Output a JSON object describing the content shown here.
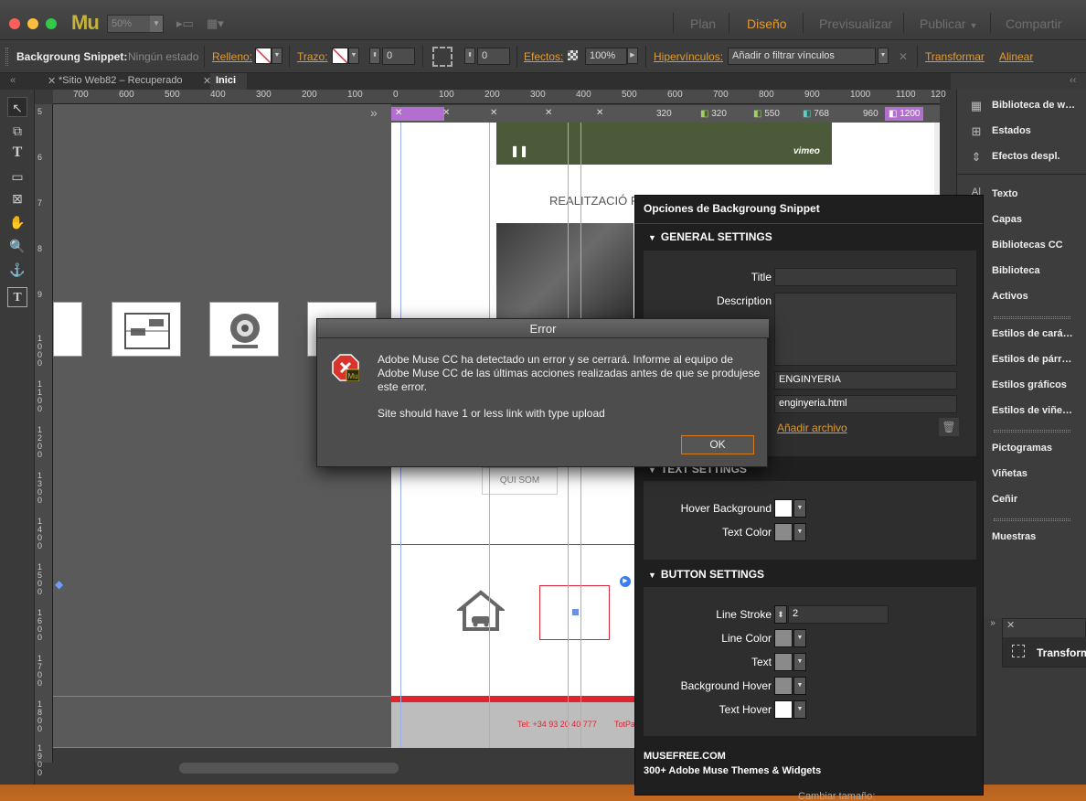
{
  "app": {
    "logo": "Mu",
    "zoom": "50%"
  },
  "modes": {
    "plan": "Plan",
    "diseno": "Diseño",
    "previsualizar": "Previsualizar",
    "publicar": "Publicar",
    "compartir": "Compartir"
  },
  "control": {
    "object_name": "Backgroung Snippet:",
    "state": "Ningún estado",
    "relleno": "Relleno:",
    "trazo": "Trazo:",
    "stroke_value": "0",
    "corner_value": "0",
    "efectos": "Efectos:",
    "opacity": "100%",
    "hipervinculos": "Hipervínculos:",
    "link_placeholder": "Añadir o filtrar vínculos",
    "transformar": "Transformar",
    "alinear": "Alinear"
  },
  "tabs": [
    {
      "label": "*Sitio Web82 – Recuperado"
    },
    {
      "label": "Inici"
    }
  ],
  "ruler_h": [
    "700",
    "600",
    "500",
    "400",
    "300",
    "200",
    "100",
    "0",
    "100",
    "200",
    "300",
    "400",
    "500",
    "600",
    "700",
    "800",
    "900",
    "1000",
    "1100",
    "120"
  ],
  "ruler_v": [
    "5",
    "6",
    "7",
    "8",
    "9",
    "1000",
    "1100",
    "1200",
    "1300",
    "1400",
    "1500",
    "1600",
    "1700",
    "1800",
    "1900"
  ],
  "breakpoints": [
    "320",
    "320",
    "550",
    "768",
    "960",
    "1200"
  ],
  "page": {
    "section_title": "REALITZACIÓ P",
    "button_label": "QUI SOM",
    "footer_phone": "Tel: +34  93 20 40 777",
    "footer_extra": "TotPa",
    "vimeo": "vimeo"
  },
  "dock": {
    "items": [
      "Biblioteca de w…",
      "Estados",
      "Efectos despl.",
      "Texto",
      "Capas",
      "Bibliotecas CC",
      "Biblioteca",
      "Activos",
      "Estilos de cará…",
      "Estilos de párr…",
      "Estilos gráficos",
      "Estilos de viñe…",
      "Pictogramas",
      "Viñetas",
      "Ceñir",
      "Muestras"
    ],
    "transform_label": "Transform"
  },
  "options": {
    "title": "Opciones de Backgroung Snippet",
    "general": "GENERAL SETTINGS",
    "title_label": "Title",
    "description_label": "Description",
    "field_name_value": "ENGINYERIA",
    "field_link_value": "enginyeria.html",
    "add_file": "Añadir archivo",
    "text_settings": "TEXT SETTINGS",
    "hover_bg": "Hover Background",
    "text_color": "Text Color",
    "button_settings": "BUTTON SETTINGS",
    "line_stroke": "Line Stroke",
    "line_stroke_value": "2",
    "line_color": "Line Color",
    "text": "Text",
    "bg_hover": "Background Hover",
    "text_hover": "Text Hover",
    "footer_line1": "MUSEFREE.COM",
    "footer_line2": "300+ Adobe Muse Themes & Widgets",
    "resize_label": "Cambiar tamaño:"
  },
  "dialog": {
    "title": "Error",
    "message": "Adobe Muse CC ha detectado un error y se cerrará. Informe al equipo de Adobe Muse CC de las últimas acciones realizadas antes de que se produjese este error.",
    "detail": "Site should have 1 or less link with type upload",
    "ok": "OK"
  },
  "colors": {
    "accent": "#e39b2e",
    "breakpoint": "#b26fd0",
    "page_red": "#e0242e",
    "close_red": "#fc605b",
    "min_yellow": "#fdbc40",
    "max_green": "#34c84a"
  }
}
